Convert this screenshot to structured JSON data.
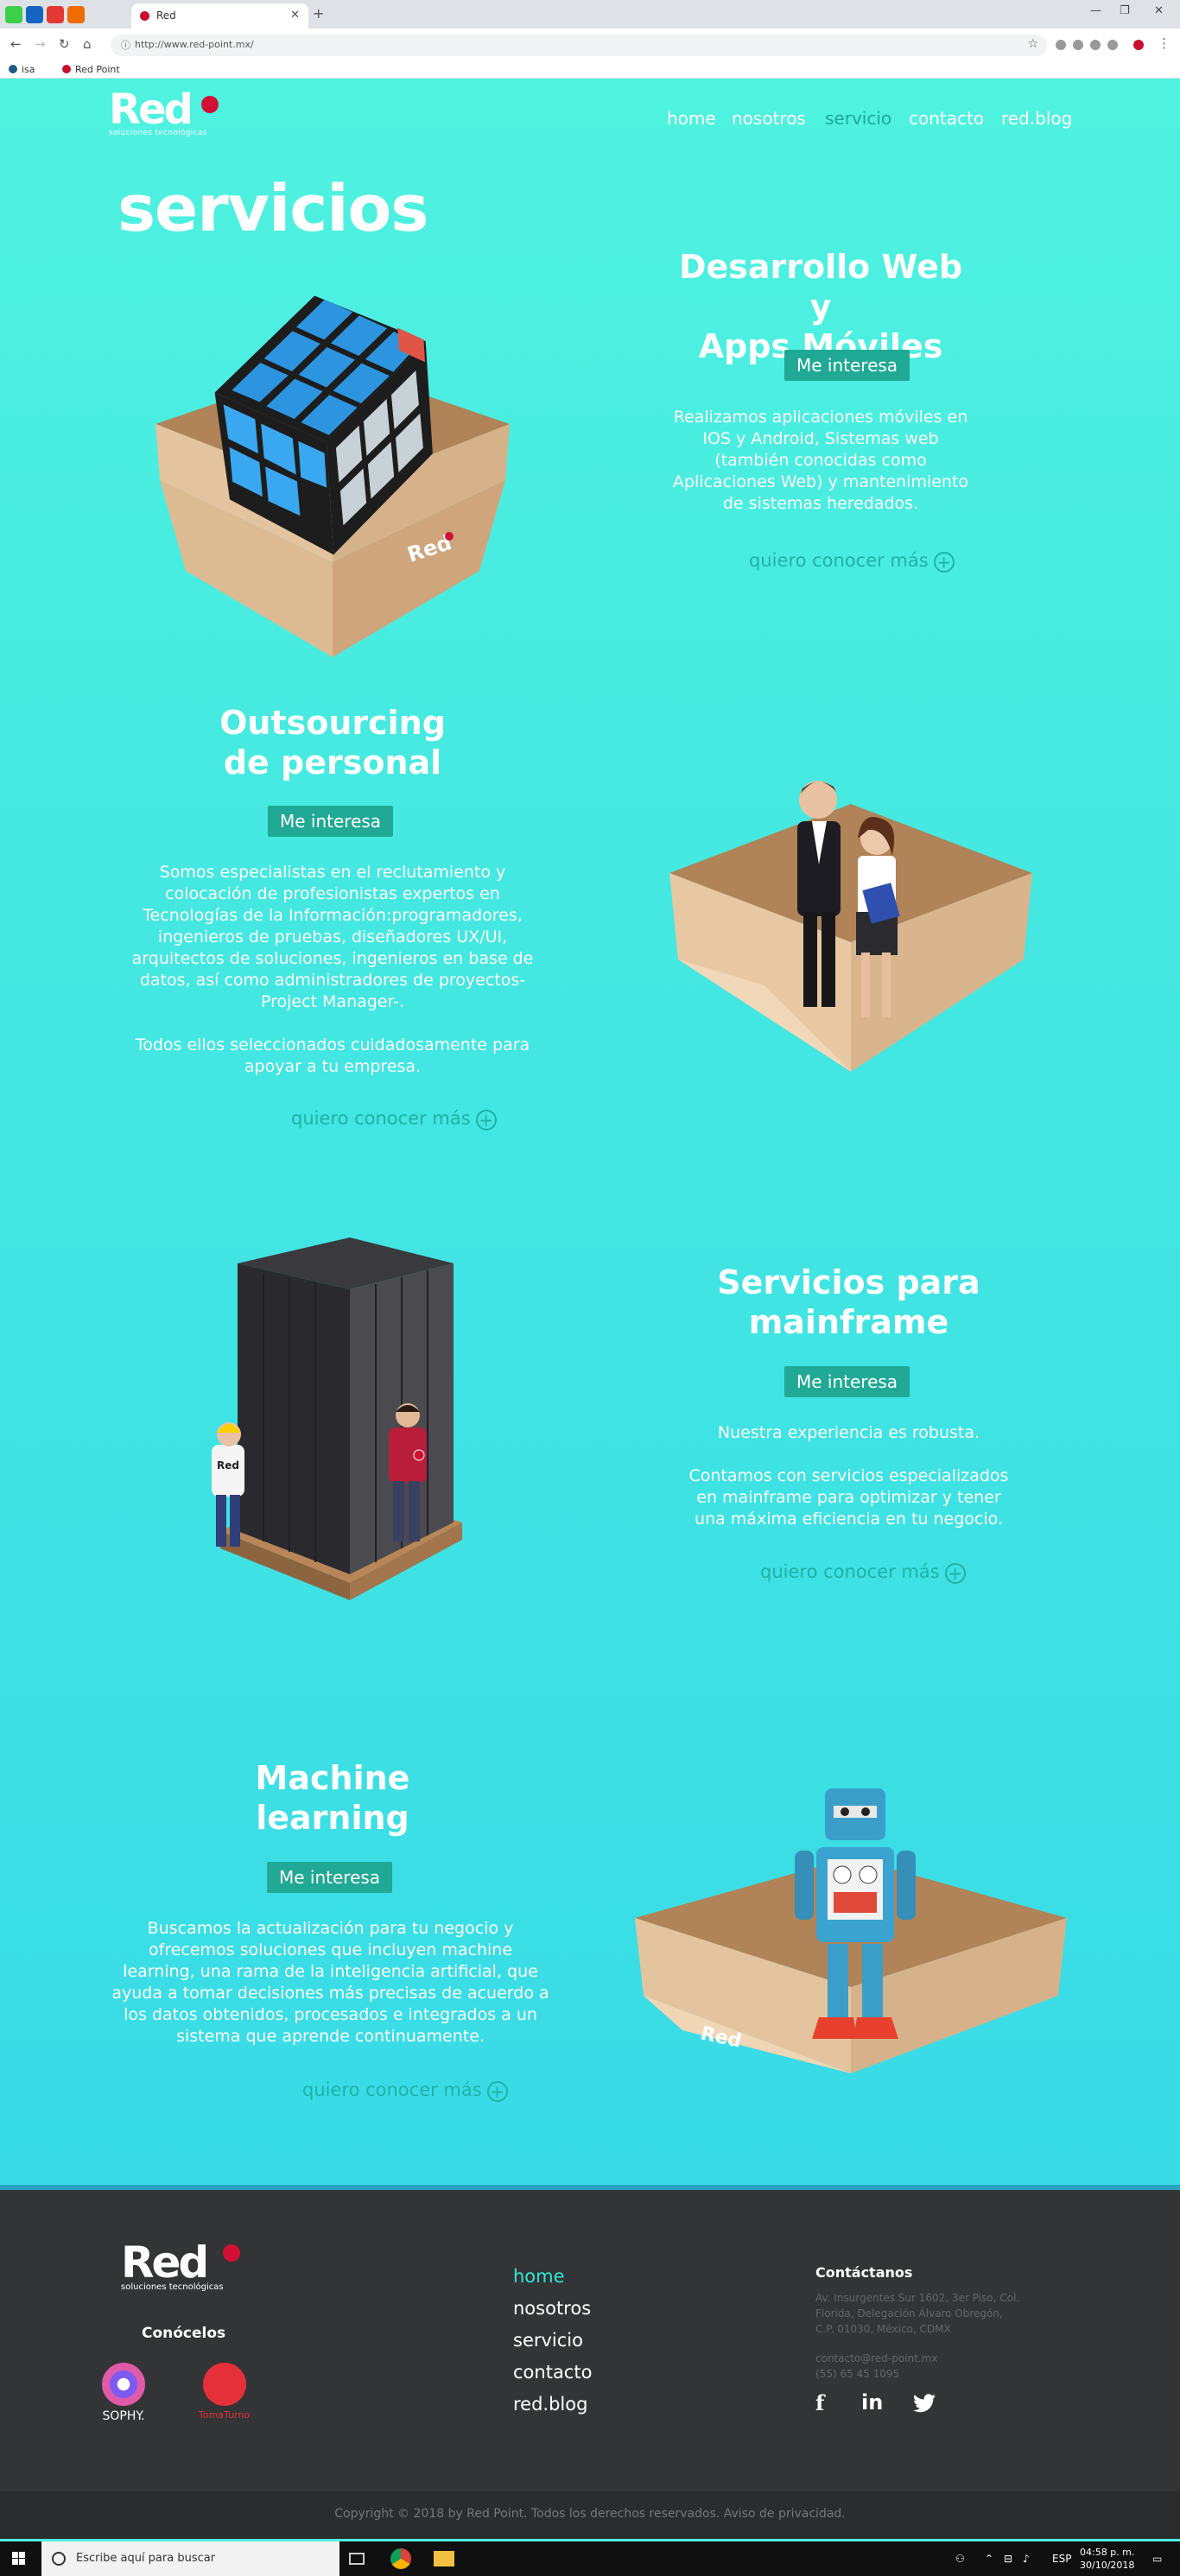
{
  "browser": {
    "tab_title": "Red",
    "url": "http://www.red-point.mx/",
    "bookmarks": [
      "isa",
      "Red Point"
    ]
  },
  "site": {
    "logo_text": "Red",
    "logo_sub": "soluciones tecnológicas",
    "nav": [
      "home",
      "nosotros",
      "servicio",
      "contacto",
      "red.blog"
    ],
    "hero_title": "servicios"
  },
  "services": [
    {
      "title_l1": "Desarrollo Web y",
      "title_l2": "Apps Móviles",
      "button": "Me interesa",
      "desc": "Realizamos aplicaciones móviles en\nIOS y Android, Sistemas web\n(también conocidas como\nAplicaciones Web) y mantenimiento\nde sistemas heredados.",
      "more": "quiero conocer más"
    },
    {
      "title_l1": "Outsourcing",
      "title_l2": "de personal",
      "button": "Me interesa",
      "desc": "Somos especialistas en el reclutamiento y\ncolocación de profesionistas expertos en\nTecnologías de la Información:programadores,\ningenieros de pruebas, diseñadores UX/UI,\narquitectos de soluciones, ingenieros en base de\ndatos, así como  administradores de proyectos-\nProject Manager-.\n\nTodos ellos seleccionados cuidadosamente para\napoyar a tu empresa.",
      "more": "quiero conocer más"
    },
    {
      "title_l1": "Servicios para",
      "title_l2": "mainframe",
      "button": "Me interesa",
      "desc": "Nuestra experiencia es robusta.\n\nContamos con servicios especializados\nen mainframe para optimizar y tener\nuna máxima eficiencia en tu negocio.",
      "more": "quiero conocer más"
    },
    {
      "title_l1": "Machine",
      "title_l2": "learning",
      "button": "Me interesa",
      "desc": "Buscamos la actualización para tu negocio y\nofrecemos soluciones que incluyen machine\nlearning, una rama de la inteligencia artificial, que\nayuda a tomar decisiones más precisas de acuerdo a\nlos datos obtenidos, procesados e integrados a un\nsistema que aprende continuamente.",
      "more": "quiero conocer más"
    }
  ],
  "footer": {
    "logo_text": "Red",
    "logo_sub": "soluciones tecnológicas",
    "conocelos": "Conócelos",
    "partners": [
      "SOPHY.",
      "TomaTurno"
    ],
    "nav": [
      "home",
      "nosotros",
      "servicio",
      "contacto",
      "red.blog"
    ],
    "contact_title": "Contáctanos",
    "address": "Av. Insurgentes Sur 1602, 3er Piso, Col.\nFlorida, Delegación Álvaro Obregón,\nC.P. 01030, México, CDMX",
    "email": "contacto@red-point.mx",
    "phone": "(55) 65 45 1095",
    "social": [
      "f",
      "in",
      "twitter"
    ],
    "copyright": "Copyright © 2018 by Red Point. Todos los derechos reservados. Aviso de privacidad."
  },
  "taskbar": {
    "search_placeholder": "Escribe aquí para buscar",
    "lang": "ESP",
    "time": "04:58 p. m.",
    "date": "30/10/2018"
  },
  "colors": {
    "accent": "#20a995",
    "brand_red": "#d21034",
    "bg_teal": "#44e8e1",
    "footer_bg": "#333436"
  }
}
